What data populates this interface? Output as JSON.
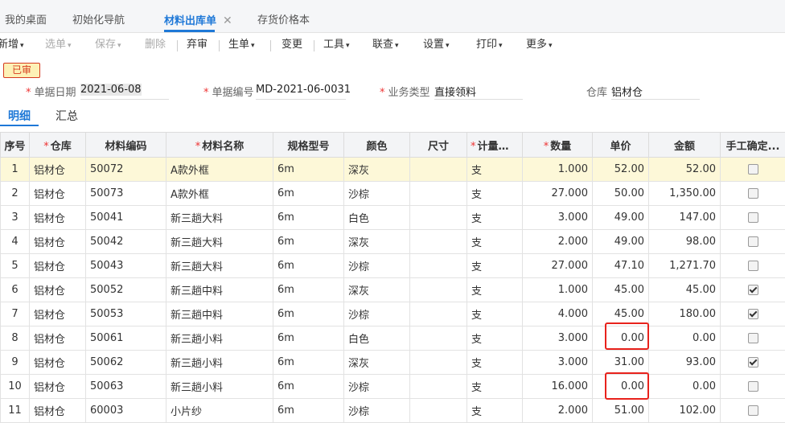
{
  "tabs": [
    {
      "label": "我的桌面"
    },
    {
      "label": "初始化导航"
    },
    {
      "label": "材料出库单",
      "close": "✕"
    },
    {
      "label": "存货价格本"
    }
  ],
  "toolbar": {
    "new": "新增",
    "select": "选单",
    "save": "保存",
    "delete": "删除",
    "abandon": "弃审",
    "generate": "生单",
    "change": "变更",
    "tools": "工具",
    "linked": "联查",
    "settings": "设置",
    "print": "打印",
    "more": "更多",
    "caret": "▾"
  },
  "status_badge": "已审",
  "form": {
    "date_label": "单据日期",
    "date_value": "2021-06-08",
    "code_label": "单据编号",
    "code_value": "MD-2021-06-0031",
    "biz_label": "业务类型",
    "biz_value": "直接领料",
    "wh_label": "仓库",
    "wh_value": "铝材仓",
    "required_mark": "*"
  },
  "detail_tabs": {
    "detail": "明细",
    "summary": "汇总"
  },
  "table": {
    "headers": [
      "序号",
      "仓库",
      "材料编码",
      "材料名称",
      "规格型号",
      "颜色",
      "尺寸",
      "计量单位",
      "数量",
      "单价",
      "金额",
      "手工确定..."
    ],
    "required_cols": [
      1,
      3,
      7,
      8
    ],
    "rows": [
      {
        "no": "1",
        "wh": "铝材仓",
        "code": "50072",
        "name": "A款外框",
        "spec": "6m",
        "color": "深灰",
        "size": "",
        "unit": "支",
        "qty": "1.000",
        "price": "52.00",
        "amount": "52.00",
        "checked": false
      },
      {
        "no": "2",
        "wh": "铝材仓",
        "code": "50073",
        "name": "A款外框",
        "spec": "6m",
        "color": "沙棕",
        "size": "",
        "unit": "支",
        "qty": "27.000",
        "price": "50.00",
        "amount": "1,350.00",
        "checked": false
      },
      {
        "no": "3",
        "wh": "铝材仓",
        "code": "50041",
        "name": "新三趟大料",
        "spec": "6m",
        "color": "白色",
        "size": "",
        "unit": "支",
        "qty": "3.000",
        "price": "49.00",
        "amount": "147.00",
        "checked": false
      },
      {
        "no": "4",
        "wh": "铝材仓",
        "code": "50042",
        "name": "新三趟大料",
        "spec": "6m",
        "color": "深灰",
        "size": "",
        "unit": "支",
        "qty": "2.000",
        "price": "49.00",
        "amount": "98.00",
        "checked": false
      },
      {
        "no": "5",
        "wh": "铝材仓",
        "code": "50043",
        "name": "新三趟大料",
        "spec": "6m",
        "color": "沙棕",
        "size": "",
        "unit": "支",
        "qty": "27.000",
        "price": "47.10",
        "amount": "1,271.70",
        "checked": false
      },
      {
        "no": "6",
        "wh": "铝材仓",
        "code": "50052",
        "name": "新三趟中料",
        "spec": "6m",
        "color": "深灰",
        "size": "",
        "unit": "支",
        "qty": "1.000",
        "price": "45.00",
        "amount": "45.00",
        "checked": true
      },
      {
        "no": "7",
        "wh": "铝材仓",
        "code": "50053",
        "name": "新三趟中料",
        "spec": "6m",
        "color": "沙棕",
        "size": "",
        "unit": "支",
        "qty": "4.000",
        "price": "45.00",
        "amount": "180.00",
        "checked": true
      },
      {
        "no": "8",
        "wh": "铝材仓",
        "code": "50061",
        "name": "新三趟小料",
        "spec": "6m",
        "color": "白色",
        "size": "",
        "unit": "支",
        "qty": "3.000",
        "price": "0.00",
        "amount": "0.00",
        "checked": false
      },
      {
        "no": "9",
        "wh": "铝材仓",
        "code": "50062",
        "name": "新三趟小料",
        "spec": "6m",
        "color": "深灰",
        "size": "",
        "unit": "支",
        "qty": "3.000",
        "price": "31.00",
        "amount": "93.00",
        "checked": true
      },
      {
        "no": "10",
        "wh": "铝材仓",
        "code": "50063",
        "name": "新三趟小料",
        "spec": "6m",
        "color": "沙棕",
        "size": "",
        "unit": "支",
        "qty": "16.000",
        "price": "0.00",
        "amount": "0.00",
        "checked": false
      },
      {
        "no": "11",
        "wh": "铝材仓",
        "code": "60003",
        "name": "小片纱",
        "spec": "6m",
        "color": "沙棕",
        "size": "",
        "unit": "支",
        "qty": "2.000",
        "price": "51.00",
        "amount": "102.00",
        "checked": false
      }
    ]
  },
  "colors": {
    "accent": "#1e78d7",
    "highlight_row": "#fdf8d8",
    "annotation": "#e8221c"
  }
}
